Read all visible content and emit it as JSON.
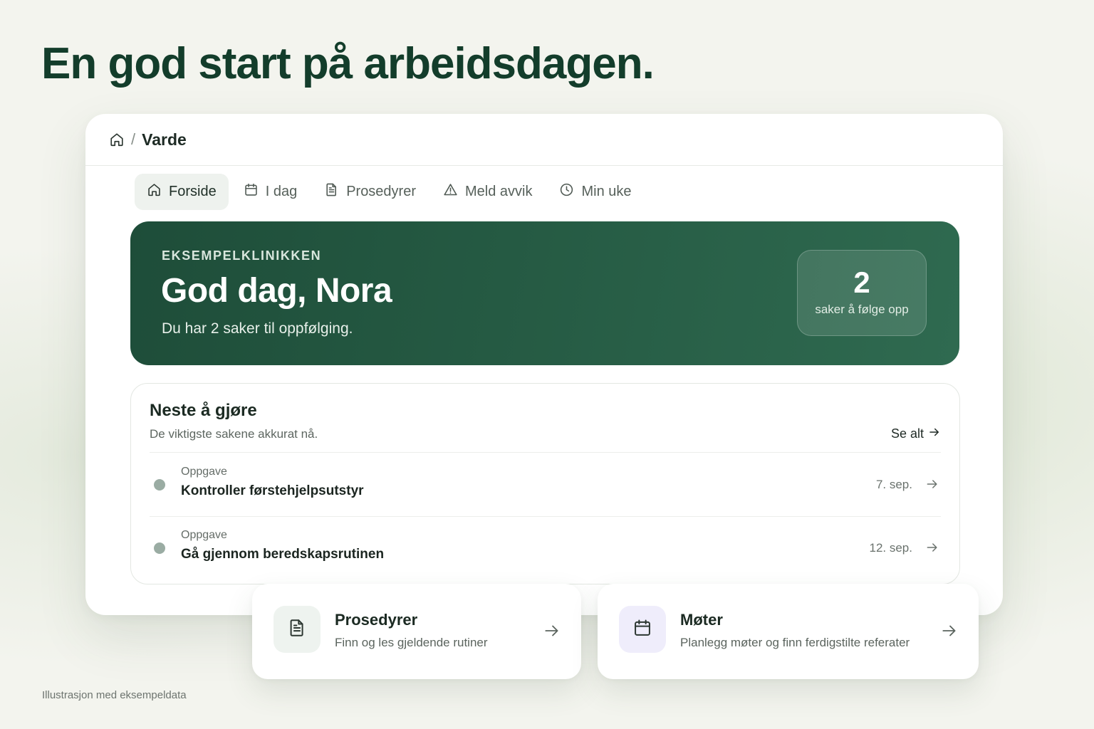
{
  "headline": "En god start på arbeidsdagen.",
  "app": {
    "breadcrumb": {
      "home_icon": "home-icon",
      "separator": "/",
      "current": "Varde"
    },
    "tabs": [
      {
        "label": "Forside",
        "icon": "home-icon",
        "active": true
      },
      {
        "label": "I dag",
        "icon": "calendar-icon",
        "active": false
      },
      {
        "label": "Prosedyrer",
        "icon": "document-icon",
        "active": false
      },
      {
        "label": "Meld avvik",
        "icon": "warning-icon",
        "active": false
      },
      {
        "label": "Min uke",
        "icon": "clock-icon",
        "active": false
      }
    ],
    "hero": {
      "eyebrow": "EKSEMPELKLINIKKEN",
      "greeting": "God dag, Nora",
      "subtitle": "Du har 2 saker til oppfølging.",
      "stat_value": "2",
      "stat_label": "saker å følge opp"
    },
    "next": {
      "title": "Neste å gjøre",
      "description": "De viktigste sakene akkurat nå.",
      "see_all": "Se alt",
      "items": [
        {
          "kind": "Oppgave",
          "name": "Kontroller førstehjelpsutstyr",
          "date": "7. sep."
        },
        {
          "kind": "Oppgave",
          "name": "Gå gjennom beredskapsrutinen",
          "date": "12. sep."
        }
      ]
    }
  },
  "quick_links": [
    {
      "title": "Prosedyrer",
      "description": "Finn og les gjeldende rutiner",
      "icon": "document-icon",
      "icon_bg": "#eef3ef"
    },
    {
      "title": "Møter",
      "description": "Planlegg møter og finn ferdigstilte referater",
      "icon": "calendar-icon",
      "icon_bg": "#efedfb"
    }
  ],
  "footnote": "Illustrasjon med eksempeldata",
  "colors": {
    "brand_dark": "#133d2b",
    "hero_bg": "#255a43",
    "status_dot": "#9aaca3"
  }
}
